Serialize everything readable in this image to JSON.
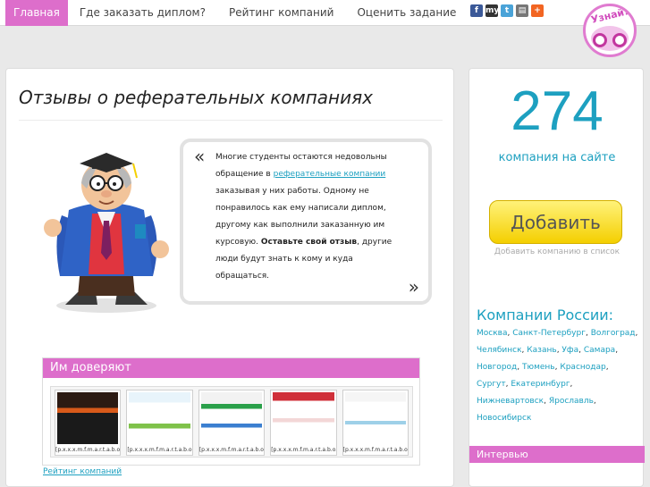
{
  "nav": {
    "items": [
      {
        "label": "Главная",
        "active": true
      },
      {
        "label": "Где заказать диплом?",
        "active": false
      },
      {
        "label": "Рейтинг компаний",
        "active": false
      },
      {
        "label": "Оценить задание",
        "active": false
      }
    ]
  },
  "social": [
    {
      "icon": "facebook-icon",
      "glyph": "f",
      "color": "#3b5998"
    },
    {
      "icon": "myworld-icon",
      "glyph": "my",
      "color": "#333333"
    },
    {
      "icon": "twitter-icon",
      "glyph": "t",
      "color": "#4aa3d8"
    },
    {
      "icon": "print-icon",
      "glyph": "▤",
      "color": "#777777"
    },
    {
      "icon": "addthis-icon",
      "glyph": "+",
      "color": "#f26522"
    }
  ],
  "logo": {
    "text": "Узнай!"
  },
  "main": {
    "title": "Отзывы о реферательных компаниях",
    "bubble": {
      "p1": "Многие студенты остаются недовольны обращение в ",
      "link": "реферательные компании",
      "p2": " заказывая у них работы. Одному не понравилось как ему написали диплом, другому как выполнили заказанную им курсовую. ",
      "bold": "Оставьте свой отзыв",
      "p3": ", другие люди будут знать к кому и куда обращаться."
    },
    "trust_title": "Им доверяют",
    "thumbs": [
      {
        "caption": "[p.x.x.x.m.f.m.a.r.t.a.b.o.m]"
      },
      {
        "caption": "[p.x.x.x.m.f.m.a.r.t.a.b.o.m]"
      },
      {
        "caption": "[p.x.x.x.m.f.m.a.r.t.a.b.o.m]"
      },
      {
        "caption": "[p.x.x.x.m.f.m.a.r.t.a.b.o.m]"
      },
      {
        "caption": "[p.x.x.x.m.f.m.a.r.t.a.b.o.m]"
      }
    ],
    "rating_link": "Рейтинг компаний"
  },
  "sidebar": {
    "count": "274",
    "count_label": "компания на сайте",
    "add_button": "Добавить",
    "add_hint": "Добавить компанию в список",
    "cities_title": "Компании России:",
    "cities": [
      "Москва",
      "Санкт-Петербург",
      "Волгоград",
      "Челябинск",
      "Казань",
      "Уфа",
      "Самара",
      "Новгород",
      "Тюмень",
      "Краснодар",
      "Сургут",
      "Екатеринбург",
      "Нижневартовск",
      "Ярославль",
      "Новосибирск"
    ],
    "interview": "Интервью"
  },
  "colors": {
    "accent": "#dd6ecb",
    "link": "#1da0c0",
    "button": "#f4cf00"
  }
}
